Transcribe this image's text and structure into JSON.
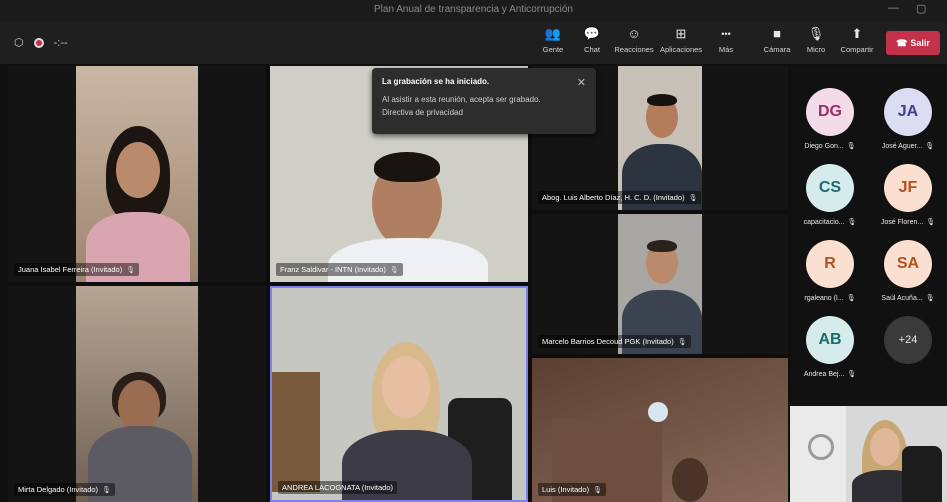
{
  "window": {
    "title": "Plan Anual de transparencia y Anticorrupción",
    "minimize": "—",
    "maximize": "▢"
  },
  "toolbar": {
    "meeting_timer": "-:--",
    "buttons": [
      {
        "label": "Gente",
        "icon": "people-icon",
        "glyph": "👥"
      },
      {
        "label": "Chat",
        "icon": "chat-icon",
        "glyph": "💬"
      },
      {
        "label": "Reacciones",
        "icon": "reactions-icon",
        "glyph": "☺"
      },
      {
        "label": "Aplicaciones",
        "icon": "apps-icon",
        "glyph": "⊞"
      },
      {
        "label": "Más",
        "icon": "more-icon",
        "glyph": "•••"
      },
      {
        "label": "Cámara",
        "icon": "camera-icon",
        "glyph": "■"
      },
      {
        "label": "Micro",
        "icon": "mic-icon",
        "glyph": "🎙"
      },
      {
        "label": "Compartir",
        "icon": "share-icon",
        "glyph": "⬆"
      }
    ],
    "leave_label": "Salir",
    "leave_color": "#c4314b"
  },
  "notification": {
    "title": "La grabación se ha iniciado.",
    "line1": "Al asistir a esta reunión, acepta ser grabado.",
    "line2": "Directiva de privacidad",
    "close_glyph": "✕"
  },
  "participants": [
    {
      "name": "Juana Isabel Ferreira (Invitado)"
    },
    {
      "name": "Franz Saldivar - INTN (Invitado)"
    },
    {
      "name": "Abog. Luis Alberto Díaz, H. C. D. (Invitado)"
    },
    {
      "name": "Marcelo Barrios Decoud PGK (Invitado)"
    },
    {
      "name": "Mirta Delgado (Invitado)"
    },
    {
      "name": "ANDREA LACOGNATA (Invitado)"
    },
    {
      "name": "Luis (Invitado)"
    }
  ],
  "mic_glyph": "🎙",
  "roster": [
    {
      "initials": "DG",
      "name": "Diego Gon...",
      "bg": "#f4dbe8",
      "fg": "#9c2d6b"
    },
    {
      "initials": "JA",
      "name": "José Aguer...",
      "bg": "#dcdcf2",
      "fg": "#3f3f8f"
    },
    {
      "initials": "CS",
      "name": "capacitacio...",
      "bg": "#d6ecec",
      "fg": "#1d6b6b"
    },
    {
      "initials": "JF",
      "name": "José Floren...",
      "bg": "#fbe0d1",
      "fg": "#b4501b"
    },
    {
      "initials": "R",
      "name": "rgaleano (I...",
      "bg": "#fbe0d1",
      "fg": "#b4501b"
    },
    {
      "initials": "SA",
      "name": "Saúl Acuña...",
      "bg": "#fbe0d1",
      "fg": "#b4501b"
    },
    {
      "initials": "AB",
      "name": "Andrea Bej...",
      "bg": "#d6ecec",
      "fg": "#1d6b6b"
    },
    {
      "initials": "+24",
      "name": "",
      "bg": "#3a3a3a",
      "fg": "#e6e6e6"
    }
  ]
}
